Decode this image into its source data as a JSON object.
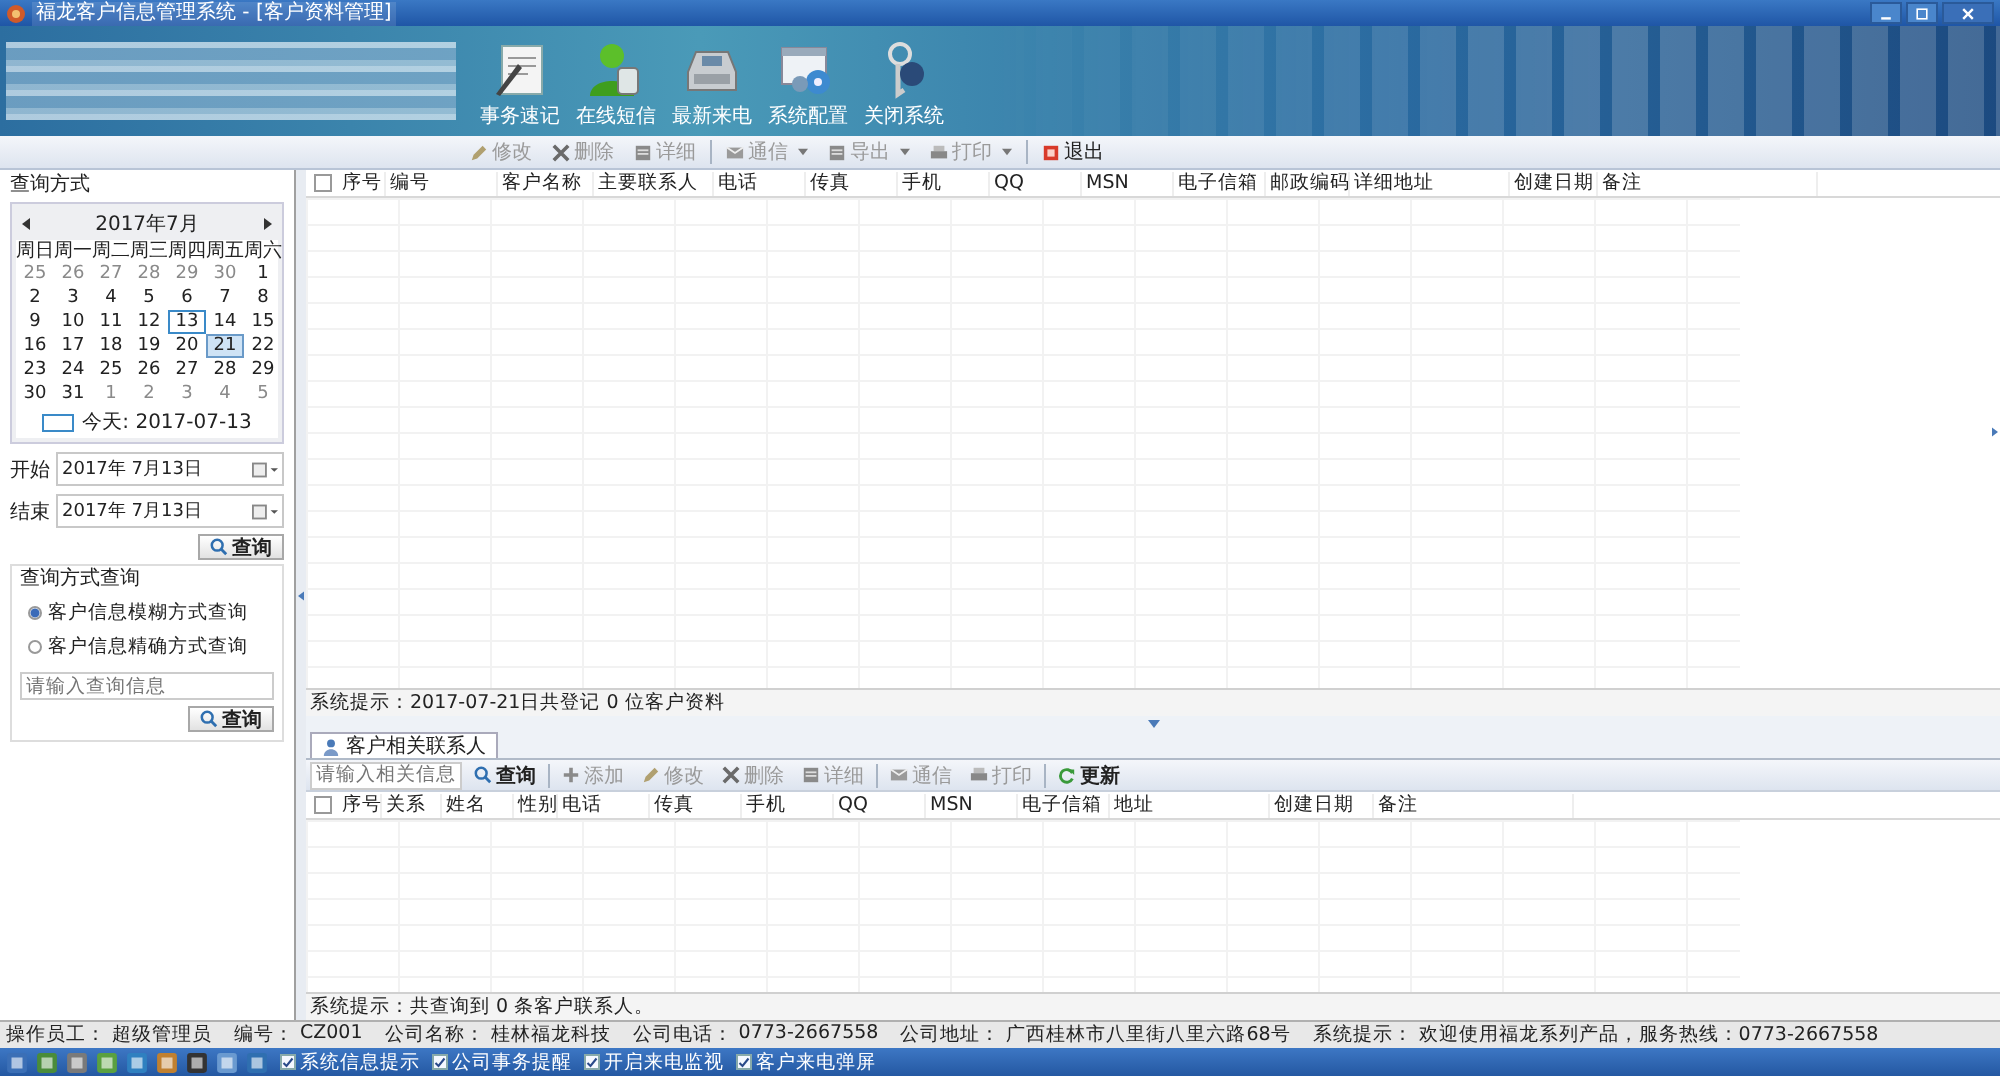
{
  "window": {
    "title": "福龙客户信息管理系统 - [客户资料管理]"
  },
  "header_buttons": [
    {
      "label": "事务速记"
    },
    {
      "label": "在线短信"
    },
    {
      "label": "最新来电"
    },
    {
      "label": "系统配置"
    },
    {
      "label": "关闭系统"
    }
  ],
  "toolbar": [
    {
      "label": "修改",
      "disabled": true,
      "dropdown": false
    },
    {
      "label": "删除",
      "disabled": true,
      "dropdown": false
    },
    {
      "label": "详细",
      "disabled": true,
      "dropdown": false
    },
    {
      "label": "通信",
      "disabled": true,
      "dropdown": true
    },
    {
      "label": "导出",
      "disabled": true,
      "dropdown": true
    },
    {
      "label": "打印",
      "disabled": true,
      "dropdown": true
    },
    {
      "label": "退出",
      "disabled": false,
      "dropdown": false
    }
  ],
  "query_panel": {
    "title": "查询方式",
    "calendar": {
      "month": "2017年7月",
      "weekdays": [
        "周日",
        "周一",
        "周二",
        "周三",
        "周四",
        "周五",
        "周六"
      ],
      "days": [
        {
          "label": "25",
          "other_month": true,
          "today": false,
          "selected": false
        },
        {
          "label": "26",
          "other_month": true,
          "today": false,
          "selected": false
        },
        {
          "label": "27",
          "other_month": true,
          "today": false,
          "selected": false
        },
        {
          "label": "28",
          "other_month": true,
          "today": false,
          "selected": false
        },
        {
          "label": "29",
          "other_month": true,
          "today": false,
          "selected": false
        },
        {
          "label": "30",
          "other_month": true,
          "today": false,
          "selected": false
        },
        {
          "label": "1",
          "other_month": false,
          "today": false,
          "selected": false
        },
        {
          "label": "2",
          "other_month": false,
          "today": false,
          "selected": false
        },
        {
          "label": "3",
          "other_month": false,
          "today": false,
          "selected": false
        },
        {
          "label": "4",
          "other_month": false,
          "today": false,
          "selected": false
        },
        {
          "label": "5",
          "other_month": false,
          "today": false,
          "selected": false
        },
        {
          "label": "6",
          "other_month": false,
          "today": false,
          "selected": false
        },
        {
          "label": "7",
          "other_month": false,
          "today": false,
          "selected": false
        },
        {
          "label": "8",
          "other_month": false,
          "today": false,
          "selected": false
        },
        {
          "label": "9",
          "other_month": false,
          "today": false,
          "selected": false
        },
        {
          "label": "10",
          "other_month": false,
          "today": false,
          "selected": false
        },
        {
          "label": "11",
          "other_month": false,
          "today": false,
          "selected": false
        },
        {
          "label": "12",
          "other_month": false,
          "today": false,
          "selected": false
        },
        {
          "label": "13",
          "other_month": false,
          "today": true,
          "selected": false
        },
        {
          "label": "14",
          "other_month": false,
          "today": false,
          "selected": false
        },
        {
          "label": "15",
          "other_month": false,
          "today": false,
          "selected": false
        },
        {
          "label": "16",
          "other_month": false,
          "today": false,
          "selected": false
        },
        {
          "label": "17",
          "other_month": false,
          "today": false,
          "selected": false
        },
        {
          "label": "18",
          "other_month": false,
          "today": false,
          "selected": false
        },
        {
          "label": "19",
          "other_month": false,
          "today": false,
          "selected": false
        },
        {
          "label": "20",
          "other_month": false,
          "today": false,
          "selected": false
        },
        {
          "label": "21",
          "other_month": false,
          "today": false,
          "selected": true
        },
        {
          "label": "22",
          "other_month": false,
          "today": false,
          "selected": false
        },
        {
          "label": "23",
          "other_month": false,
          "today": false,
          "selected": false
        },
        {
          "label": "24",
          "other_month": false,
          "today": false,
          "selected": false
        },
        {
          "label": "25",
          "other_month": false,
          "today": false,
          "selected": false
        },
        {
          "label": "26",
          "other_month": false,
          "today": false,
          "selected": false
        },
        {
          "label": "27",
          "other_month": false,
          "today": false,
          "selected": false
        },
        {
          "label": "28",
          "other_month": false,
          "today": false,
          "selected": false
        },
        {
          "label": "29",
          "other_month": false,
          "today": false,
          "selected": false
        },
        {
          "label": "30",
          "other_month": false,
          "today": false,
          "selected": false
        },
        {
          "label": "31",
          "other_month": false,
          "today": false,
          "selected": false
        },
        {
          "label": "1",
          "other_month": true,
          "today": false,
          "selected": false
        },
        {
          "label": "2",
          "other_month": true,
          "today": false,
          "selected": false
        },
        {
          "label": "3",
          "other_month": true,
          "today": false,
          "selected": false
        },
        {
          "label": "4",
          "other_month": true,
          "today": false,
          "selected": false
        },
        {
          "label": "5",
          "other_month": true,
          "today": false,
          "selected": false
        }
      ],
      "today_label": "今天: 2017-07-13"
    },
    "start": {
      "label": "开始",
      "value": "2017年 7月13日"
    },
    "end": {
      "label": "结束",
      "value": "2017年 7月13日"
    },
    "date_query_button": "查询",
    "mode_group": {
      "title": "查询方式查询",
      "options": [
        {
          "label": "客户信息模糊方式查询",
          "selected": true
        },
        {
          "label": "客户信息精确方式查询",
          "selected": false
        }
      ],
      "search": {
        "placeholder": "请输入查询信息"
      },
      "button": "查询"
    }
  },
  "customers": {
    "select_all_checked": false,
    "columns": [
      "序号",
      "编号",
      "客户名称",
      "主要联系人",
      "电话",
      "传真",
      "手机",
      "QQ",
      "MSN",
      "电子信箱",
      "邮政编码",
      "详细地址",
      "创建日期",
      "备注"
    ],
    "status": "系统提示：2017-07-21日共登记 0 位客户资料"
  },
  "contacts": {
    "select_all_checked": false,
    "tabs": [
      {
        "label": "客户相关联系人",
        "selected": true
      }
    ],
    "search": {
      "placeholder": "请输入相关信息"
    },
    "toolbar": [
      {
        "label": "查询",
        "disabled": false
      },
      {
        "label": "添加",
        "disabled": true
      },
      {
        "label": "修改",
        "disabled": true
      },
      {
        "label": "删除",
        "disabled": true
      },
      {
        "label": "详细",
        "disabled": true
      },
      {
        "label": "通信",
        "disabled": true
      },
      {
        "label": "打印",
        "disabled": true
      },
      {
        "label": "更新",
        "disabled": false
      }
    ],
    "columns": [
      "序号",
      "关系",
      "姓名",
      "性别",
      "电话",
      "传真",
      "手机",
      "QQ",
      "MSN",
      "电子信箱",
      "地址",
      "创建日期",
      "备注"
    ],
    "status": "系统提示：共查询到 0 条客户联系人。"
  },
  "status_bar": [
    {
      "label": "操作员工：",
      "value": "超级管理员"
    },
    {
      "label": "编号：",
      "value": "CZ001"
    },
    {
      "label": "公司名称：",
      "value": "桂林福龙科技"
    },
    {
      "label": "公司电话：",
      "value": "0773-2667558"
    },
    {
      "label": "公司地址：",
      "value": "广西桂林市八里街八里六路68号"
    },
    {
      "label": "系统提示：",
      "value": "欢迎使用福龙系列产品，服务热线：0773-2667558"
    }
  ],
  "taskbar": {
    "options": [
      {
        "label": "系统信息提示",
        "checked": true
      },
      {
        "label": "公司事务提醒",
        "checked": true
      },
      {
        "label": "开启来电监视",
        "checked": true
      },
      {
        "label": "客户来电弹屏",
        "checked": true
      }
    ]
  }
}
